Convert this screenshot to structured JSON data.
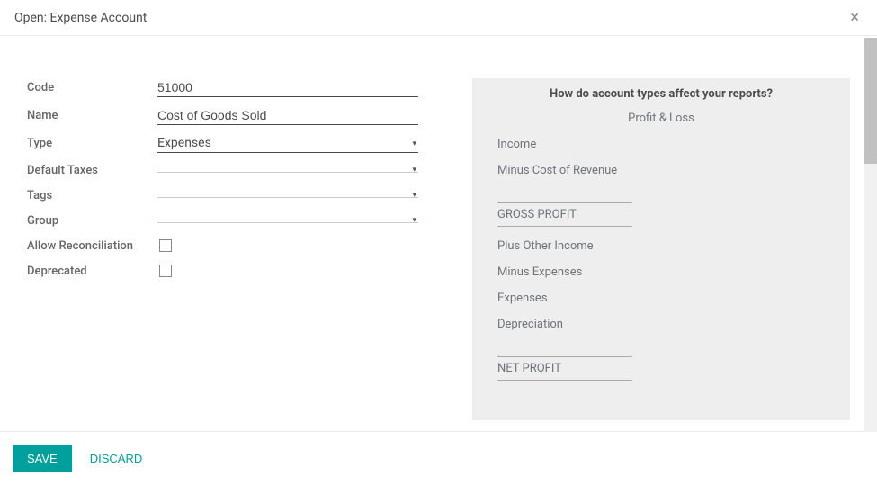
{
  "dialog": {
    "title": "Open: Expense Account"
  },
  "form": {
    "code": {
      "label": "Code",
      "value": "51000"
    },
    "name": {
      "label": "Name",
      "value": "Cost of Goods Sold"
    },
    "type": {
      "label": "Type",
      "value": "Expenses"
    },
    "default_taxes": {
      "label": "Default Taxes",
      "value": ""
    },
    "tags": {
      "label": "Tags",
      "value": ""
    },
    "group": {
      "label": "Group",
      "value": ""
    },
    "allow_reconciliation": {
      "label": "Allow Reconciliation",
      "checked": false
    },
    "deprecated": {
      "label": "Deprecated",
      "checked": false
    }
  },
  "info": {
    "title": "How do account types affect your reports?",
    "subtitle": "Profit & Loss",
    "lines": {
      "income": "Income",
      "minus_cor": "Minus Cost of Revenue",
      "gross_profit": "GROSS PROFIT",
      "plus_other": "Plus Other Income",
      "minus_expenses": "Minus Expenses",
      "expenses": "Expenses",
      "depreciation": "Depreciation",
      "net_profit": "NET PROFIT"
    }
  },
  "footer": {
    "save": "SAVE",
    "discard": "DISCARD"
  }
}
